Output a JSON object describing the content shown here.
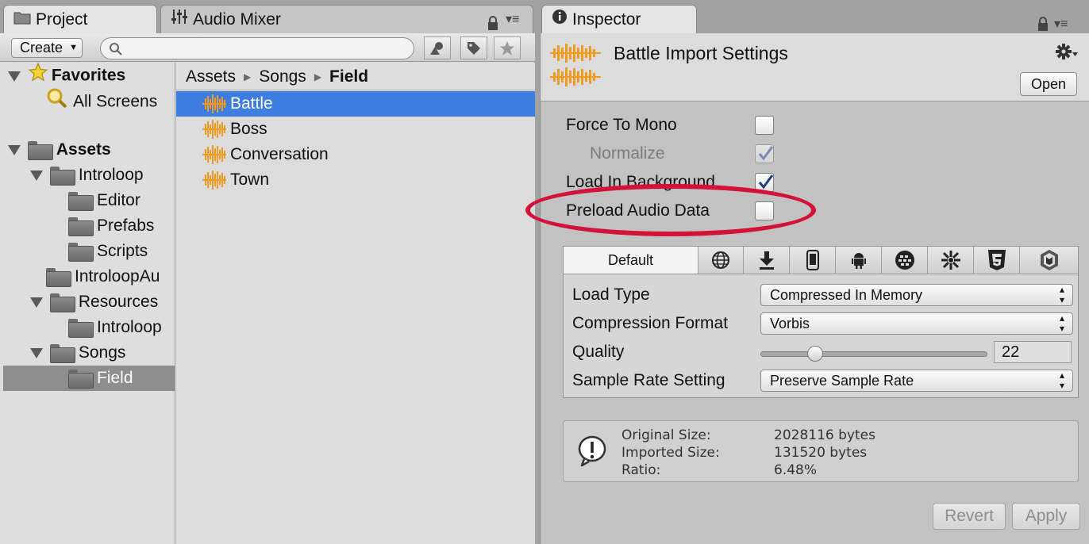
{
  "tabs": {
    "project": "Project",
    "audio_mixer": "Audio Mixer",
    "inspector": "Inspector"
  },
  "project": {
    "create_label": "Create",
    "search_placeholder": "",
    "tree": [
      {
        "label": "Favorites",
        "bold": true
      },
      {
        "label": "All Screens"
      },
      {
        "label": "Assets",
        "bold": true
      },
      {
        "label": "Introloop"
      },
      {
        "label": "Editor"
      },
      {
        "label": "Prefabs"
      },
      {
        "label": "Scripts"
      },
      {
        "label": "IntroloopAu"
      },
      {
        "label": "Resources"
      },
      {
        "label": "Introloop"
      },
      {
        "label": "Songs"
      },
      {
        "label": "Field",
        "selected": true
      }
    ],
    "breadcrumb": [
      "Assets",
      "Songs",
      "Field"
    ],
    "files": [
      {
        "label": "Battle",
        "selected": true
      },
      {
        "label": "Boss"
      },
      {
        "label": "Conversation"
      },
      {
        "label": "Town"
      }
    ]
  },
  "inspector": {
    "title": "Battle Import Settings",
    "open_label": "Open",
    "options": [
      {
        "label": "Force To Mono",
        "checked": false
      },
      {
        "label": "Normalize",
        "checked": true,
        "disabled": true
      },
      {
        "label": "Load In Background",
        "checked": true
      },
      {
        "label": "Preload Audio Data",
        "checked": false
      }
    ],
    "platform_tabs": {
      "default": "Default",
      "icons": [
        "globe-icon",
        "download-icon",
        "phone-icon",
        "android-icon",
        "blackberry-icon",
        "tizen-icon",
        "html5-icon",
        "samsung-tv-icon"
      ]
    },
    "settings": {
      "load_type_label": "Load Type",
      "load_type_value": "Compressed In Memory",
      "compression_label": "Compression Format",
      "compression_value": "Vorbis",
      "quality_label": "Quality",
      "quality_value": "22",
      "quality_fraction": 0.22,
      "sample_rate_label": "Sample Rate Setting",
      "sample_rate_value": "Preserve Sample Rate"
    },
    "info": {
      "original_label": "Original Size:",
      "original_value": "2028116 bytes",
      "imported_label": "Imported Size:",
      "imported_value": "131520 bytes",
      "ratio_label": "Ratio:",
      "ratio_value": "6.48%"
    },
    "revert_label": "Revert",
    "apply_label": "Apply"
  },
  "colors": {
    "selection": "#3e7de1",
    "audio_icon": "#f29a1f",
    "annotation": "#d3123a"
  }
}
